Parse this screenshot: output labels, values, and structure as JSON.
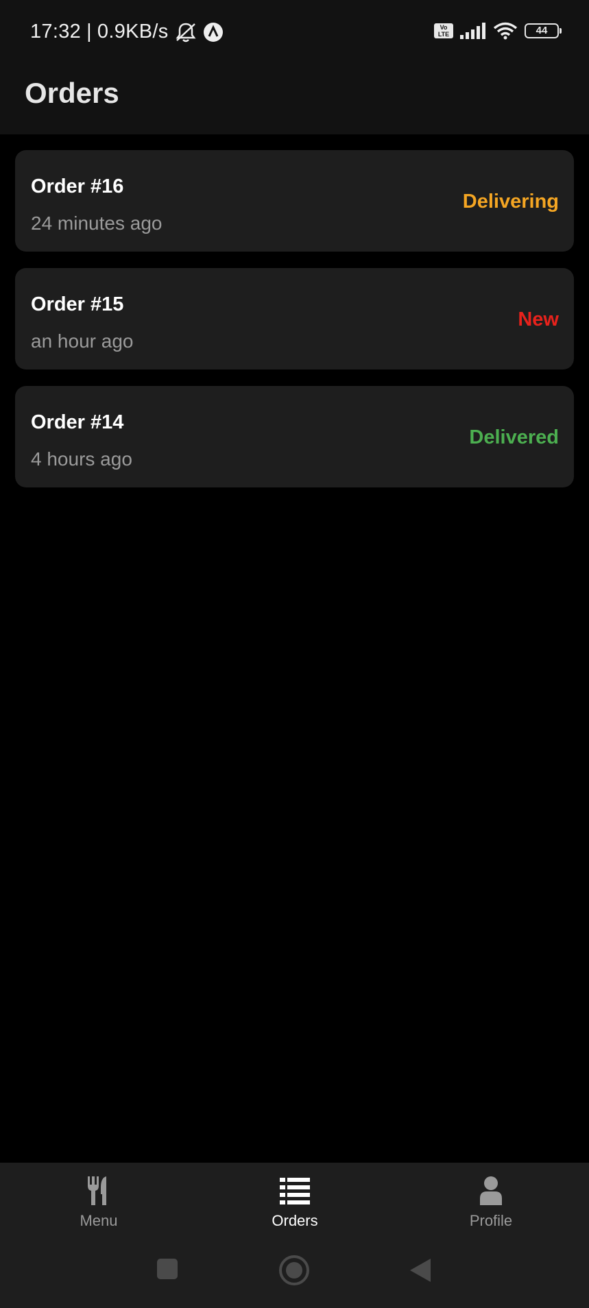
{
  "status_bar": {
    "time": "17:32",
    "separator": "|",
    "network_speed": "0.9KB/s",
    "volte_label": "Vo\nLTE",
    "battery_level": "44",
    "icons": [
      "mute-notifications-icon",
      "app-notification-icon",
      "volte-icon",
      "signal-icon",
      "wifi-icon",
      "battery-icon"
    ]
  },
  "header": {
    "title": "Orders"
  },
  "orders": [
    {
      "title": "Order #16",
      "time": "24 minutes ago",
      "status": "Delivering",
      "status_color": "#f5a623"
    },
    {
      "title": "Order #15",
      "time": "an hour ago",
      "status": "New",
      "status_color": "#e8221c"
    },
    {
      "title": "Order #14",
      "time": "4 hours ago",
      "status": "Delivered",
      "status_color": "#4caf50"
    }
  ],
  "bottom_nav": {
    "items": [
      {
        "label": "Menu",
        "icon": "fork-knife-icon",
        "active": false
      },
      {
        "label": "Orders",
        "icon": "list-icon",
        "active": true
      },
      {
        "label": "Profile",
        "icon": "person-icon",
        "active": false
      }
    ]
  },
  "system_nav": {
    "icons": [
      "recent-apps-icon",
      "home-icon",
      "back-icon"
    ]
  },
  "colors": {
    "background": "#000000",
    "surface": "#1e1e1e",
    "header": "#121212",
    "muted_text": "#9b9b9b"
  }
}
